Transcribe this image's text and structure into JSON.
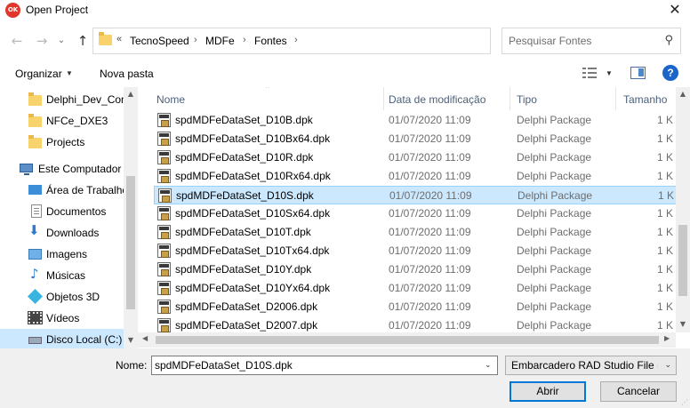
{
  "window": {
    "icon_text": "OK",
    "title": "Open Project",
    "close": "✕"
  },
  "nav": {
    "back": "←",
    "forward": "→",
    "recent": "⌄",
    "up": "↑"
  },
  "address": {
    "overflow": "«",
    "crumbs": [
      "TecnoSpeed",
      "MDFe",
      "Fontes"
    ],
    "separator": "›",
    "refresh": "↻"
  },
  "search": {
    "placeholder": "Pesquisar Fontes",
    "icon": "⚲"
  },
  "toolbar": {
    "organize": "Organizar",
    "new_folder": "Nova pasta",
    "help": "?"
  },
  "sidebar": {
    "items": [
      {
        "label": "Delphi_Dev_Con",
        "icon": "folder"
      },
      {
        "label": "NFCe_DXE3",
        "icon": "folder"
      },
      {
        "label": "Projects",
        "icon": "folder"
      },
      {
        "label": "Este Computador",
        "icon": "computer"
      },
      {
        "label": "Área de Trabalho",
        "icon": "desktop"
      },
      {
        "label": "Documentos",
        "icon": "documents"
      },
      {
        "label": "Downloads",
        "icon": "downloads"
      },
      {
        "label": "Imagens",
        "icon": "images"
      },
      {
        "label": "Músicas",
        "icon": "music"
      },
      {
        "label": "Objetos 3D",
        "icon": "3d-objects"
      },
      {
        "label": "Vídeos",
        "icon": "videos"
      },
      {
        "label": "Disco Local (C:)",
        "icon": "drive"
      }
    ]
  },
  "columns": {
    "name": "Nome",
    "date": "Data de modificação",
    "type": "Tipo",
    "size": "Tamanho"
  },
  "files": [
    {
      "name": "spdMDFeDataSet_D10B.dpk",
      "date": "01/07/2020 11:09",
      "type": "Delphi Package",
      "size": "1 K"
    },
    {
      "name": "spdMDFeDataSet_D10Bx64.dpk",
      "date": "01/07/2020 11:09",
      "type": "Delphi Package",
      "size": "1 K"
    },
    {
      "name": "spdMDFeDataSet_D10R.dpk",
      "date": "01/07/2020 11:09",
      "type": "Delphi Package",
      "size": "1 K"
    },
    {
      "name": "spdMDFeDataSet_D10Rx64.dpk",
      "date": "01/07/2020 11:09",
      "type": "Delphi Package",
      "size": "1 K"
    },
    {
      "name": "spdMDFeDataSet_D10S.dpk",
      "date": "01/07/2020 11:09",
      "type": "Delphi Package",
      "size": "1 K",
      "selected": true
    },
    {
      "name": "spdMDFeDataSet_D10Sx64.dpk",
      "date": "01/07/2020 11:09",
      "type": "Delphi Package",
      "size": "1 K"
    },
    {
      "name": "spdMDFeDataSet_D10T.dpk",
      "date": "01/07/2020 11:09",
      "type": "Delphi Package",
      "size": "1 K"
    },
    {
      "name": "spdMDFeDataSet_D10Tx64.dpk",
      "date": "01/07/2020 11:09",
      "type": "Delphi Package",
      "size": "1 K"
    },
    {
      "name": "spdMDFeDataSet_D10Y.dpk",
      "date": "01/07/2020 11:09",
      "type": "Delphi Package",
      "size": "1 K"
    },
    {
      "name": "spdMDFeDataSet_D10Yx64.dpk",
      "date": "01/07/2020 11:09",
      "type": "Delphi Package",
      "size": "1 K"
    },
    {
      "name": "spdMDFeDataSet_D2006.dpk",
      "date": "01/07/2020 11:09",
      "type": "Delphi Package",
      "size": "1 K"
    },
    {
      "name": "spdMDFeDataSet_D2007.dpk",
      "date": "01/07/2020 11:09",
      "type": "Delphi Package",
      "size": "1 K"
    }
  ],
  "footer": {
    "name_label": "Nome:",
    "name_value": "spdMDFeDataSet_D10S.dpk",
    "filter": "Embarcadero RAD Studio File (*",
    "open": "Abrir",
    "cancel": "Cancelar"
  },
  "colors": {
    "selection": "#cce8ff",
    "selection_border": "#99d1ff",
    "accent": "#0078d7",
    "app_icon": "#e0362b"
  }
}
